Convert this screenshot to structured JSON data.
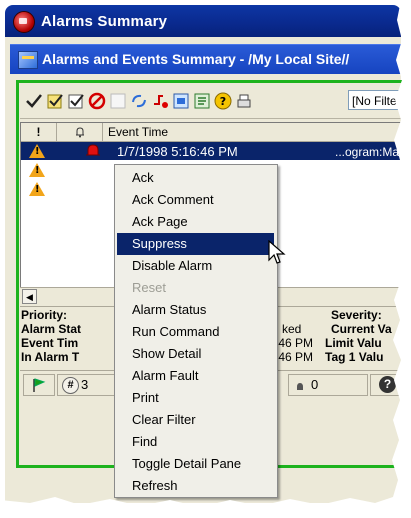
{
  "window": {
    "title": "Alarms Summary"
  },
  "panel": {
    "title": "Alarms and Events Summary - /My Local Site//"
  },
  "toolbar": {
    "icons": [
      "ack-icon",
      "ack-comment-icon",
      "ack-page-icon",
      "suppress-icon",
      "blank-icon",
      "refresh-icon",
      "alarm-fault-icon",
      "status-icon",
      "detail-icon",
      "help-icon",
      "print-icon"
    ],
    "filter_value": "[No Filter]"
  },
  "grid": {
    "columns": [
      "!",
      "",
      "Event Time"
    ],
    "rows": [
      {
        "event_time": "1/7/1998 5:16:46 PM",
        "source": "...ogram:Ma",
        "selected": true
      }
    ]
  },
  "context_menu": {
    "items": [
      {
        "label": "Ack",
        "state": "normal"
      },
      {
        "label": "Ack Comment",
        "state": "normal"
      },
      {
        "label": "Ack Page",
        "state": "normal"
      },
      {
        "label": "Suppress",
        "state": "highlighted"
      },
      {
        "label": "Disable Alarm",
        "state": "normal"
      },
      {
        "label": "Reset",
        "state": "disabled"
      },
      {
        "label": "Alarm Status",
        "state": "normal"
      },
      {
        "label": "Run Command",
        "state": "normal"
      },
      {
        "label": "Show Detail",
        "state": "normal"
      },
      {
        "label": "Alarm Fault",
        "state": "normal"
      },
      {
        "label": "Print",
        "state": "normal"
      },
      {
        "label": "Clear Filter",
        "state": "normal"
      },
      {
        "label": "Find",
        "state": "normal"
      },
      {
        "label": "Toggle Detail Pane",
        "state": "normal"
      },
      {
        "label": "Refresh",
        "state": "normal"
      }
    ]
  },
  "details": {
    "priority_label": "Priority:",
    "alarm_state_label": "Alarm Stat",
    "alarm_state_value": "ked",
    "event_time_label": "Event Tim",
    "event_time_value": ":46 PM",
    "in_alarm_label": "In Alarm T",
    "in_alarm_value": ":46 PM",
    "severity_label": "Severity:",
    "current_value_label": "Current Va",
    "limit_value_label": "Limit Valu",
    "tag1_value_label": "Tag 1 Valu"
  },
  "status_bar": {
    "count_label": "3",
    "alarm_count": "0"
  },
  "colors": {
    "titlebar": "#0a2a8f",
    "inner_titlebar": "#1644c0",
    "selection": "#0a246a",
    "frame_green": "#1db31d"
  }
}
